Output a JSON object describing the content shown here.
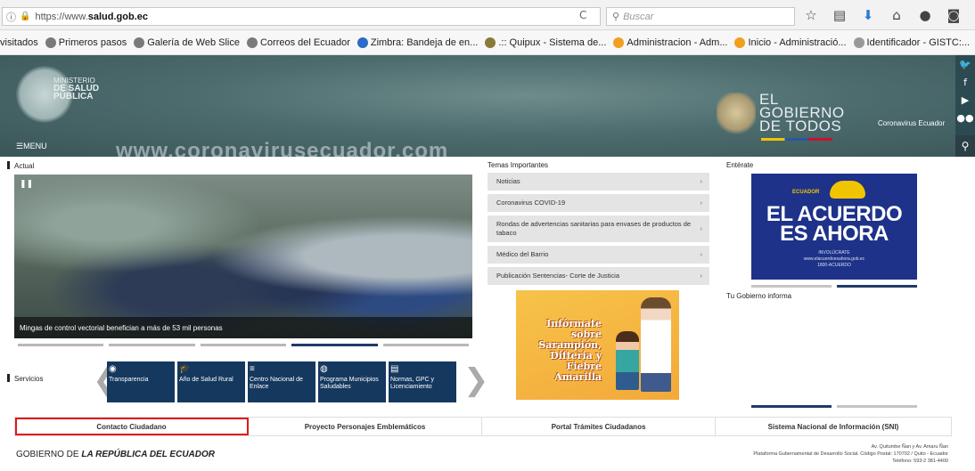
{
  "browser": {
    "url_protocol": "https://www.",
    "url_domain": "salud.gob.ec",
    "search_placeholder": "Buscar",
    "toolbar_icons": [
      "star-icon",
      "reading-list-icon",
      "download-icon",
      "home-icon",
      "chat-icon",
      "pocket-icon",
      "hamburger-icon"
    ]
  },
  "bookmarks": [
    {
      "label": "visitados",
      "color": "#999999"
    },
    {
      "label": "Primeros pasos",
      "color": "#7a7a7a"
    },
    {
      "label": "Galería de Web Slice",
      "color": "#7a7a7a"
    },
    {
      "label": "Correos del Ecuador",
      "color": "#7a7a7a"
    },
    {
      "label": "Zimbra: Bandeja de en...",
      "color": "#2a6cc4"
    },
    {
      "label": ".:: Quipux - Sistema de...",
      "color": "#8a7a3a"
    },
    {
      "label": "Administracion - Adm...",
      "color": "#f0a020"
    },
    {
      "label": "Inicio - Administració...",
      "color": "#f0a020"
    },
    {
      "label": "Identificador - GISTC:...",
      "color": "#999999"
    }
  ],
  "header": {
    "ministerio_top": "MINISTERIO",
    "ministerio_mid": "DE SALUD",
    "ministerio_bot": "PÚBLICA",
    "gobierno_l1": "EL",
    "gobierno_l2": "GOBIERNO",
    "gobierno_l3": "DE TODOS",
    "coronavirus_link": "Coronavirus Ecuador",
    "menu_label": "MENU",
    "watermark": "www.coronavirusecuador.com"
  },
  "social": [
    "twitter-icon",
    "facebook-icon",
    "youtube-icon",
    "flickr-icon",
    "search-icon"
  ],
  "sections": {
    "actual": "Actual",
    "temas": "Temas Importantes",
    "enterate": "Entérate",
    "gobierno_informa": "Tu Gobierno informa",
    "servicios": "Servicios"
  },
  "hero": {
    "caption": "Mingas de control vectorial benefician a más de 53 mil personas",
    "slides": 5,
    "active_slide": 3
  },
  "temas": [
    "Noticias",
    "Coronavirus COVID-19",
    "Rondas de advertencias sanitarias para envases de productos de tabaco",
    "Médico del Barrio",
    "Publicación Sentencias- Corte de Justicia"
  ],
  "vacuna_banner": {
    "l1": "Infórmate sobre",
    "l2": "Sarampión,",
    "l3": "Difteria y",
    "l4": "Fiebre Amarilla"
  },
  "acuerdo_banner": {
    "tag": "ECUADOR",
    "line1": "EL ACUERDO",
    "line2": "ES AHORA",
    "small1": "INVOLÚCRATE",
    "small2": "www.elacuerdoesahora.gob.ec",
    "small3": "1800-ACUERDO"
  },
  "servicios": [
    {
      "icon": "eye-icon",
      "glyph": "◉",
      "label": "Transparencia"
    },
    {
      "icon": "graduation-cap-icon",
      "glyph": "🎓",
      "label": "Año de Salud Rural"
    },
    {
      "icon": "list-icon",
      "glyph": "≡",
      "label": "Centro Nacional de Enlace"
    },
    {
      "icon": "globe-icon",
      "glyph": "◍",
      "label": "Programa Municipios Saludables"
    },
    {
      "icon": "document-icon",
      "glyph": "▤",
      "label": "Normas, GPC y Licenciamiento"
    }
  ],
  "tabs": [
    "Contacto Ciudadano",
    "Proyecto Personajes Emblemáticos",
    "Portal Trámites Ciudadanos",
    "Sistema Nacional de Información (SNI)"
  ],
  "footer": {
    "left_a": "GOBIERNO DE ",
    "left_b": "LA REPÚBLICA DEL ECUADOR",
    "addr1": "Av. Quitumbe Ñan y Av. Amaru Ñan",
    "addr2": "Plataforma Gubernamental de Desarrollo Social. Código Postal: 170702 / Quito - Ecuador",
    "addr3": "Teléfono: 593-2 381-4400"
  }
}
